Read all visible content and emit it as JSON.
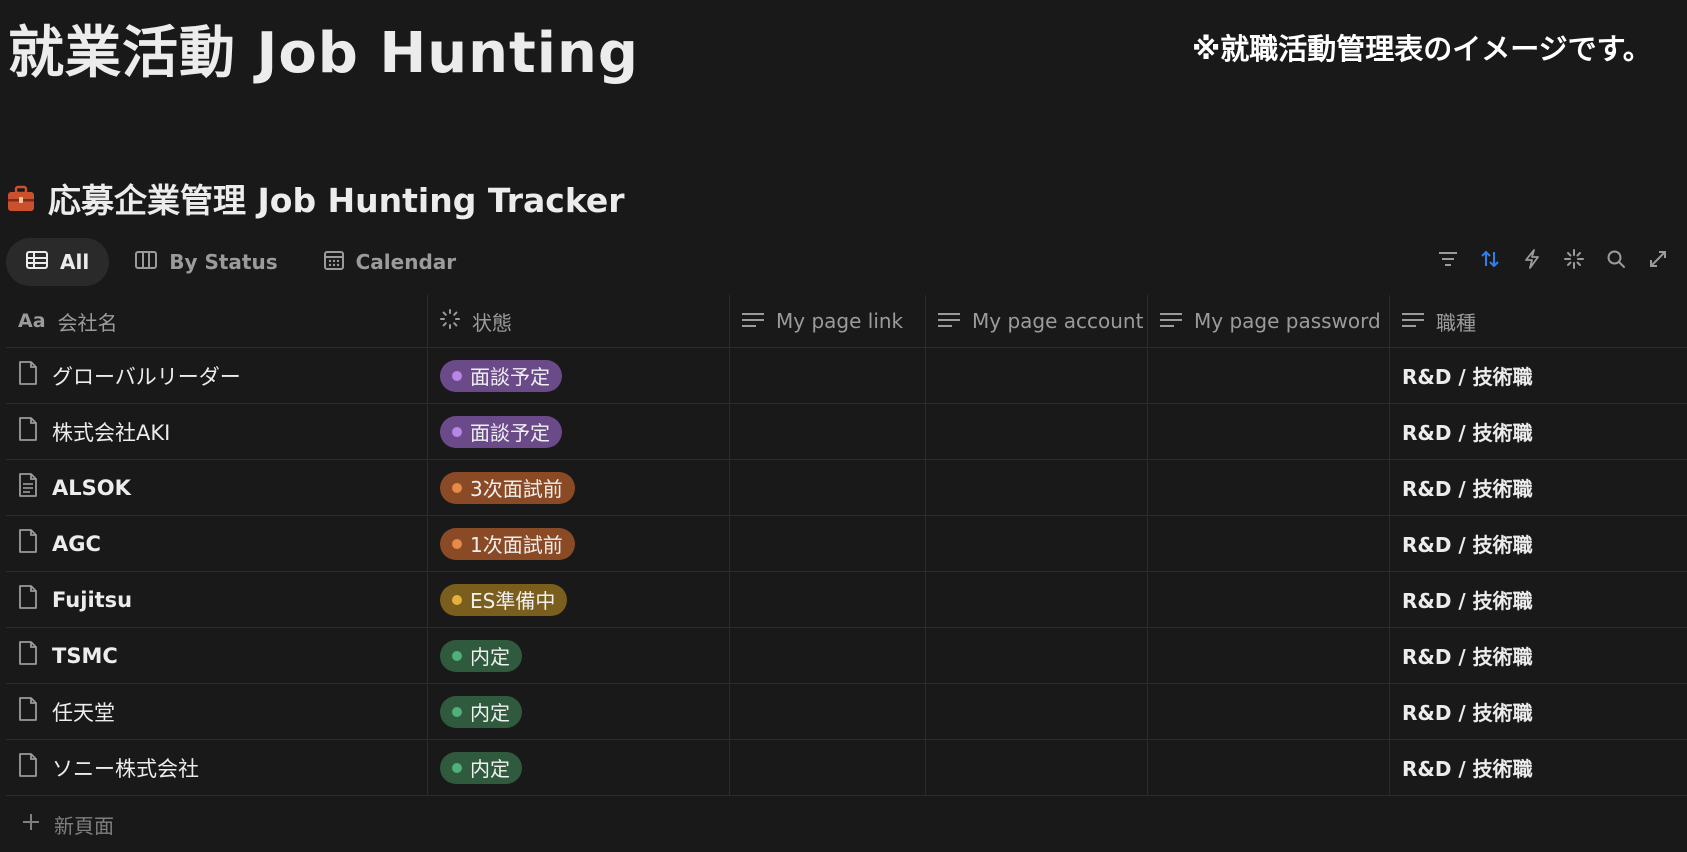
{
  "page": {
    "title": "就業活動 Job Hunting",
    "note": "※就職活動管理表のイメージです。"
  },
  "database": {
    "title": "応募企業管理 Job Hunting Tracker",
    "icon": "briefcase-icon"
  },
  "views": [
    {
      "label": "All",
      "icon": "table-icon",
      "active": true
    },
    {
      "label": "By Status",
      "icon": "board-icon",
      "active": false
    },
    {
      "label": "Calendar",
      "icon": "calendar-icon",
      "active": false
    }
  ],
  "toolbar_icons": [
    "filter-icon",
    "sort-icon",
    "automation-icon",
    "ai-sparkle-icon",
    "search-icon",
    "expand-icon"
  ],
  "colors": {
    "background": "#191919",
    "sort_active": "#2f80ed",
    "status_purple_bg": "#6b4a8a",
    "status_purple_dot": "#b886e6",
    "status_orange_bg": "#8a4a26",
    "status_orange_dot": "#e58a48",
    "status_yellow_bg": "#7a5e1e",
    "status_yellow_dot": "#e4b23a",
    "status_green_bg": "#2f5a3d",
    "status_green_dot": "#4fb07a"
  },
  "columns": [
    {
      "label": "会社名",
      "icon": "title-aa-icon"
    },
    {
      "label": "状態",
      "icon": "status-icon"
    },
    {
      "label": "My page link",
      "icon": "text-lines-icon"
    },
    {
      "label": "My page account",
      "icon": "text-lines-icon"
    },
    {
      "label": "My page password",
      "icon": "text-lines-icon"
    },
    {
      "label": "職種",
      "icon": "text-lines-icon"
    }
  ],
  "rows": [
    {
      "name": "グローバルリーダー",
      "bold": false,
      "doc_icon": "page-icon",
      "status": "面談予定",
      "status_color": "purple",
      "link": "",
      "account": "",
      "password": "",
      "role": "R&D / 技術職"
    },
    {
      "name": "株式会社AKI",
      "bold": false,
      "doc_icon": "page-icon",
      "status": "面談予定",
      "status_color": "purple",
      "link": "",
      "account": "",
      "password": "",
      "role": "R&D / 技術職"
    },
    {
      "name": "ALSOK",
      "bold": true,
      "doc_icon": "page-text-icon",
      "status": "3次面試前",
      "status_color": "orange",
      "link": "",
      "account": "",
      "password": "",
      "role": "R&D / 技術職"
    },
    {
      "name": "AGC",
      "bold": true,
      "doc_icon": "page-icon",
      "status": "1次面試前",
      "status_color": "orange",
      "link": "",
      "account": "",
      "password": "",
      "role": "R&D / 技術職"
    },
    {
      "name": "Fujitsu",
      "bold": true,
      "doc_icon": "page-icon",
      "status": "ES準備中",
      "status_color": "yellow",
      "link": "",
      "account": "",
      "password": "",
      "role": "R&D / 技術職"
    },
    {
      "name": "TSMC",
      "bold": true,
      "doc_icon": "page-icon",
      "status": "内定",
      "status_color": "green",
      "link": "",
      "account": "",
      "password": "",
      "role": "R&D / 技術職"
    },
    {
      "name": "任天堂",
      "bold": false,
      "doc_icon": "page-icon",
      "status": "内定",
      "status_color": "green",
      "link": "",
      "account": "",
      "password": "",
      "role": "R&D / 技術職"
    },
    {
      "name": "ソニー株式会社",
      "bold": false,
      "doc_icon": "page-icon",
      "status": "内定",
      "status_color": "green",
      "link": "",
      "account": "",
      "password": "",
      "role": "R&D / 技術職"
    }
  ],
  "new_row_label": "新頁面"
}
